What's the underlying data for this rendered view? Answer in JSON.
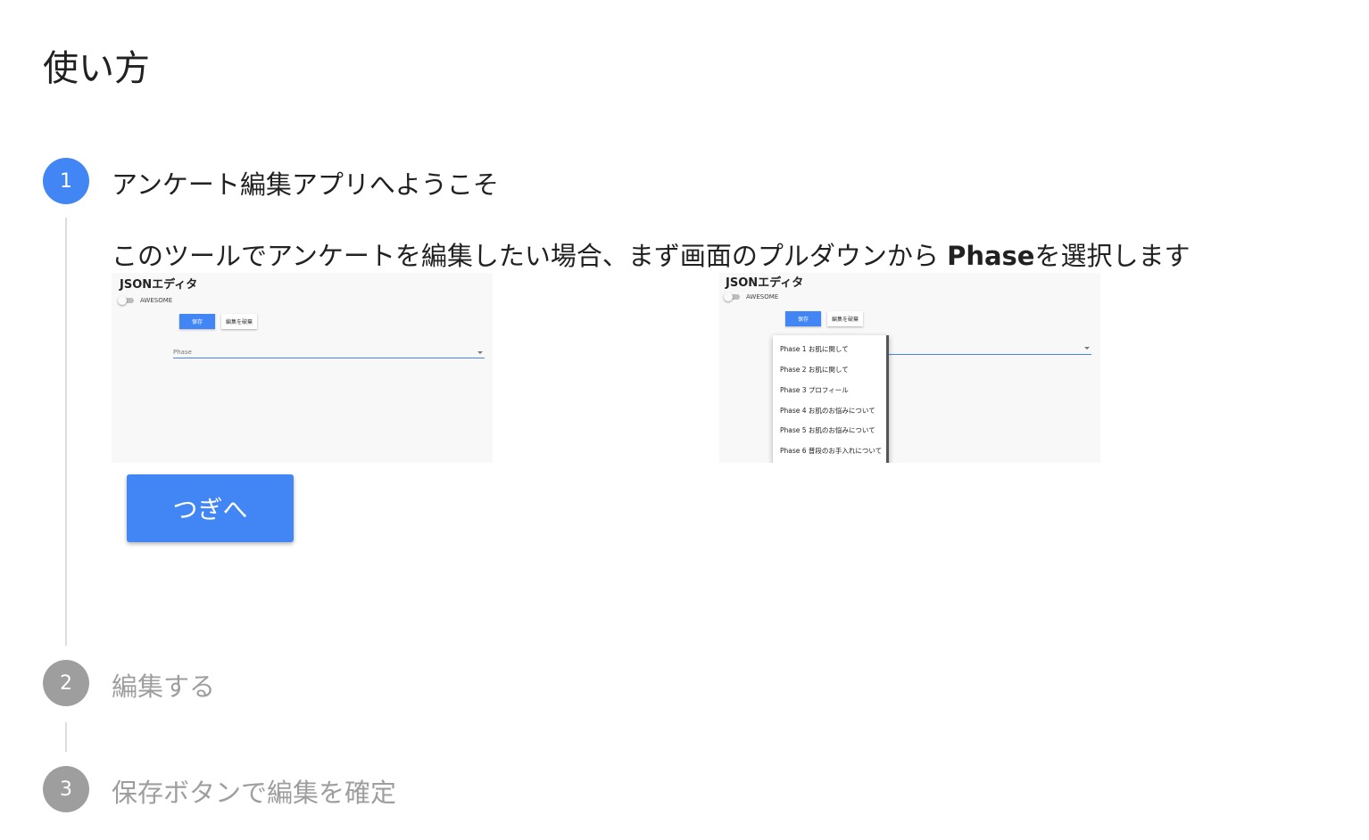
{
  "title": "使い方",
  "steps": [
    {
      "number": "1",
      "label": "アンケート編集アプリへようこそ"
    },
    {
      "number": "2",
      "label": "編集する"
    },
    {
      "number": "3",
      "label": "保存ボタンで編集を確定"
    }
  ],
  "step1": {
    "desc_before": "このツールでアンケートを編集したい場合、まず画面のプルダウンから ",
    "desc_bold": "Phase",
    "desc_after": "を選択します",
    "next_button": "つぎへ"
  },
  "screenshot_left": {
    "title": "JSONエディタ",
    "toggle_label": "AWESOME",
    "save_label": "保存",
    "cancel_label": "編集を破棄",
    "select_label": "Phase"
  },
  "screenshot_right": {
    "title": "JSONエディタ",
    "toggle_label": "AWESOME",
    "save_label": "保存",
    "cancel_label": "編集を破棄",
    "menu_items": [
      "Phase 1 お肌に関して",
      "Phase 2 お肌に関して",
      "Phase 3 プロフィール",
      "Phase 4 お肌のお悩みについて",
      "Phase 5 お肌のお悩みについて",
      "Phase 6 普段のお手入れについて"
    ]
  },
  "colors": {
    "accent": "#4286f5",
    "inactive": "#9e9e9e"
  }
}
